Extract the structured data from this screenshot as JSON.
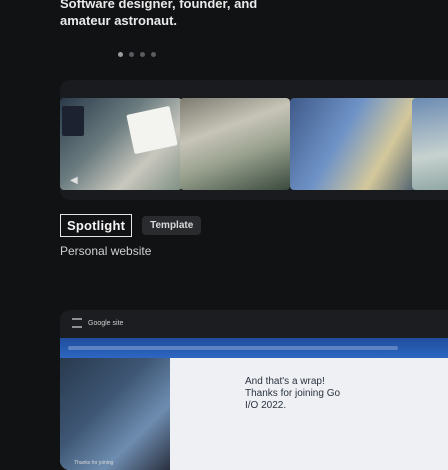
{
  "hero": {
    "line1": "Software designer, founder, and",
    "line2": "amateur astronaut."
  },
  "carousel": {
    "dot_count": 4,
    "active_index": 0
  },
  "project": {
    "brand_label": "Spotlight",
    "tag_label": "Template",
    "subtitle": "Personal website"
  },
  "preview": {
    "top_label": "Google site",
    "note_line1": "And that's a wrap!",
    "note_line2": "Thanks for joining Go",
    "note_line3": "I/O 2022.",
    "photo_caption": "Thanks for joining"
  },
  "colors": {
    "background": "#111214",
    "card": "#1a1b1e",
    "banner": "#2d66c2"
  }
}
